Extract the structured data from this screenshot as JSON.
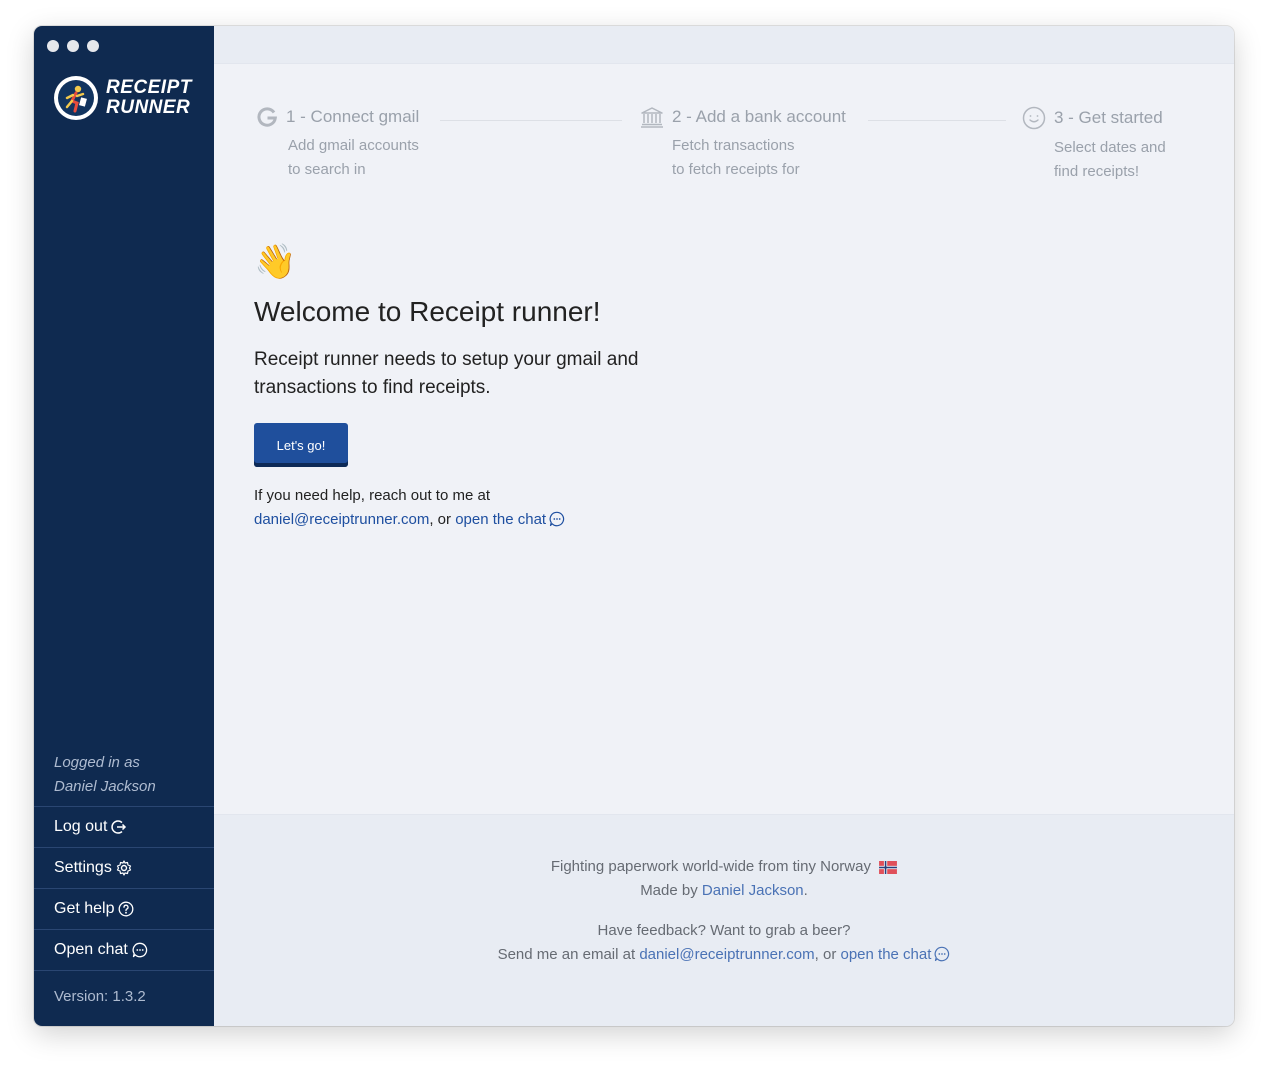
{
  "app": {
    "logo_line1": "RECEIPT",
    "logo_line2": "RUNNER",
    "logo_icon": "runner-logo-icon"
  },
  "sidebar": {
    "logged_in_label": "Logged in as",
    "user_name": "Daniel Jackson",
    "items": [
      {
        "label": "Log out",
        "icon": "logout-icon"
      },
      {
        "label": "Settings",
        "icon": "gear-icon"
      },
      {
        "label": "Get help",
        "icon": "help-circle-icon"
      },
      {
        "label": "Open chat",
        "icon": "chat-icon"
      }
    ],
    "version": "Version: 1.3.2"
  },
  "steps": [
    {
      "title": "1 - Connect gmail",
      "desc1": "Add gmail accounts",
      "desc2": "to search in",
      "icon": "google-g-icon"
    },
    {
      "title": "2 - Add a bank account",
      "desc1": "Fetch transactions",
      "desc2": "to fetch receipts for",
      "icon": "bank-icon"
    },
    {
      "title": "3 - Get started",
      "desc1": "Select dates and",
      "desc2": "find receipts!",
      "icon": "smiley-icon"
    }
  ],
  "welcome": {
    "emoji": "👋",
    "title": "Welcome to Receipt runner!",
    "intro": "Receipt runner needs to setup your gmail and transactions to find receipts.",
    "button_label": "Let's go!",
    "help_text": "If you need help, reach out to me at",
    "email": "daniel@receiptrunner.com",
    "or_text": ", or",
    "chat_link": "open the chat"
  },
  "footer": {
    "line1": "Fighting paperwork world-wide from tiny Norway",
    "made_by": "Made by",
    "author": "Daniel Jackson",
    "period": ".",
    "feedback": "Have feedback? Want to grab a beer?",
    "send_text": "Send me an email at",
    "email": "daniel@receiptrunner.com",
    "or_text": ", or",
    "chat_link": "open the chat"
  },
  "colors": {
    "sidebar": "#0f2a50",
    "accent": "#1f4f9c",
    "link": "#1e4fa0",
    "background": "#f0f2f7"
  }
}
